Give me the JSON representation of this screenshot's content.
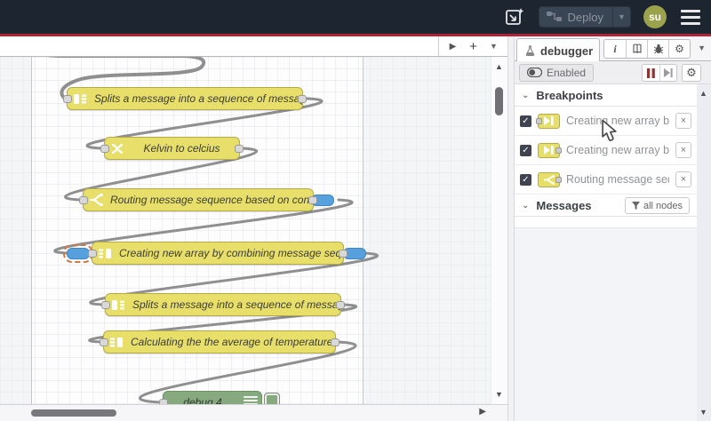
{
  "header": {
    "deploy_label": "Deploy",
    "avatar_text": "su"
  },
  "icons": {
    "chevron_down": "▾",
    "caret_down": "▼",
    "caret_up": "▲",
    "caret_right": "▶",
    "plus": "+",
    "play": "▶",
    "close": "×",
    "check": "✓",
    "info": "i",
    "gear": "⚙",
    "collapse": "⌄"
  },
  "canvas": {
    "nodes": [
      {
        "type": "split",
        "label": "Splits a message into a sequence of messages."
      },
      {
        "type": "change",
        "label": "Kelvin to celcius"
      },
      {
        "type": "switch",
        "label": "Routing message sequence based on condition"
      },
      {
        "type": "join",
        "label": "Creating new array by combining message sequence"
      },
      {
        "type": "split",
        "label": "Splits a message into a sequence of messages."
      },
      {
        "type": "join",
        "label": "Calculating the the average of temperature"
      },
      {
        "type": "debug",
        "label": "debug 4"
      }
    ]
  },
  "sidebar": {
    "tab_label": "debugger",
    "toolbar": {
      "enabled_label": "Enabled"
    },
    "breakpoints": {
      "title": "Breakpoints",
      "items": [
        {
          "label": "Creating new array by combining message sequence",
          "port": "input"
        },
        {
          "label": "Creating new array by combining message sequence",
          "port": "output"
        },
        {
          "label": "Routing message sequence based on condition",
          "port": "output"
        }
      ]
    },
    "messages": {
      "title": "Messages",
      "filter_label": "all nodes"
    }
  },
  "colors": {
    "header_bg": "#1d2531",
    "accent_red": "#b02334",
    "node_yellow": "#e7df6a",
    "node_border": "#b4ab4e",
    "debug_green": "#87a980",
    "breakpoint_blue": "#55a0dd",
    "avatar_olive": "#9aa24b",
    "wire_gray": "#8f8f8f"
  }
}
